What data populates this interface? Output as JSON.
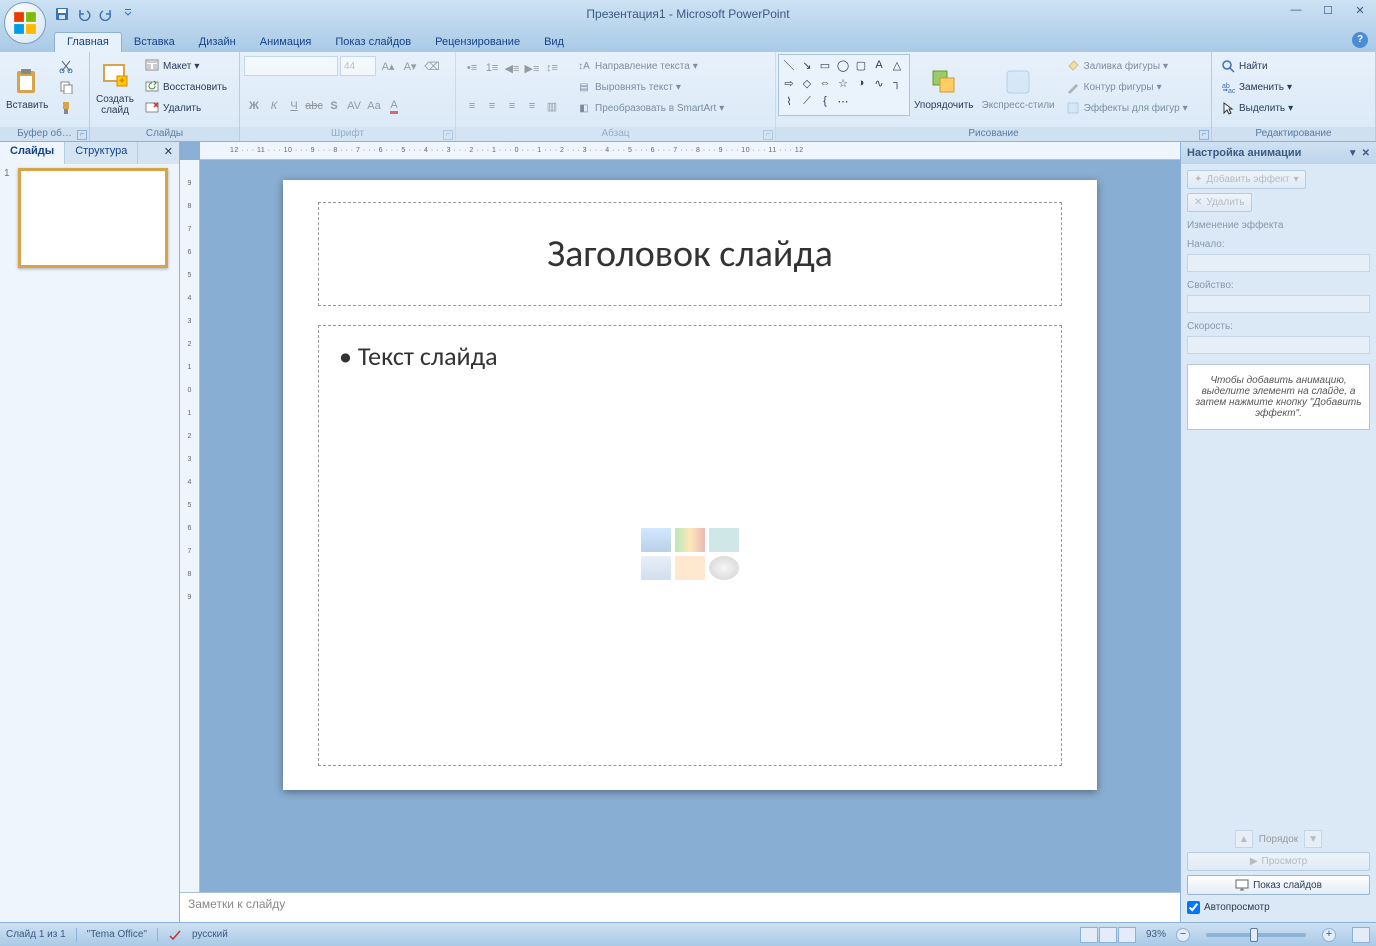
{
  "title": "Презентация1 - Microsoft PowerPoint",
  "tabs": {
    "home": "Главная",
    "insert": "Вставка",
    "design": "Дизайн",
    "animation": "Анимация",
    "slideshow": "Показ слайдов",
    "review": "Рецензирование",
    "view": "Вид"
  },
  "ribbon": {
    "clipboard": {
      "label": "Буфер об…",
      "paste": "Вставить"
    },
    "slides": {
      "label": "Слайды",
      "new_slide": "Создать\nслайд",
      "layout": "Макет",
      "reset": "Восстановить",
      "delete": "Удалить"
    },
    "font": {
      "label": "Шрифт",
      "size": "44"
    },
    "paragraph": {
      "label": "Абзац",
      "text_direction": "Направление текста",
      "align_text": "Выровнять текст",
      "convert_smartart": "Преобразовать в SmartArt"
    },
    "drawing": {
      "label": "Рисование",
      "arrange": "Упорядочить",
      "quick_styles": "Экспресс-стили",
      "shape_fill": "Заливка фигуры",
      "shape_outline": "Контур фигуры",
      "shape_effects": "Эффекты для фигур"
    },
    "editing": {
      "label": "Редактирование",
      "find": "Найти",
      "replace": "Заменить",
      "select": "Выделить"
    }
  },
  "panel": {
    "slides_tab": "Слайды",
    "outline_tab": "Структура",
    "thumb_num": "1"
  },
  "ruler_h": "12 · · · 11 · · · 10 · · · 9 · · · 8 · · · 7 · · · 6 · · · 5 · · · 4 · · · 3 · · · 2 · · · 1 · · · 0 · · · 1 · · · 2 · · · 3 · · · 4 · · · 5 · · · 6 · · · 7 · · · 8 · · · 9 · · · 10 · · · 11 · · · 12",
  "slide": {
    "title": "Заголовок слайда",
    "body": "Текст слайда"
  },
  "notes_placeholder": "Заметки к слайду",
  "anim": {
    "title": "Настройка анимации",
    "add_effect": "Добавить эффект",
    "remove": "Удалить",
    "change_effect": "Изменение эффекта",
    "start": "Начало:",
    "property": "Свойство:",
    "speed": "Скорость:",
    "hint": "Чтобы добавить анимацию, выделите элемент на слайде, а затем нажмите кнопку \"Добавить эффект\".",
    "reorder": "Порядок",
    "preview": "Просмотр",
    "slideshow": "Показ слайдов",
    "autopreview": "Автопросмотр"
  },
  "status": {
    "slide_count": "Слайд 1 из 1",
    "theme": "\"Tema Office\"",
    "language": "русский",
    "zoom": "93%"
  }
}
